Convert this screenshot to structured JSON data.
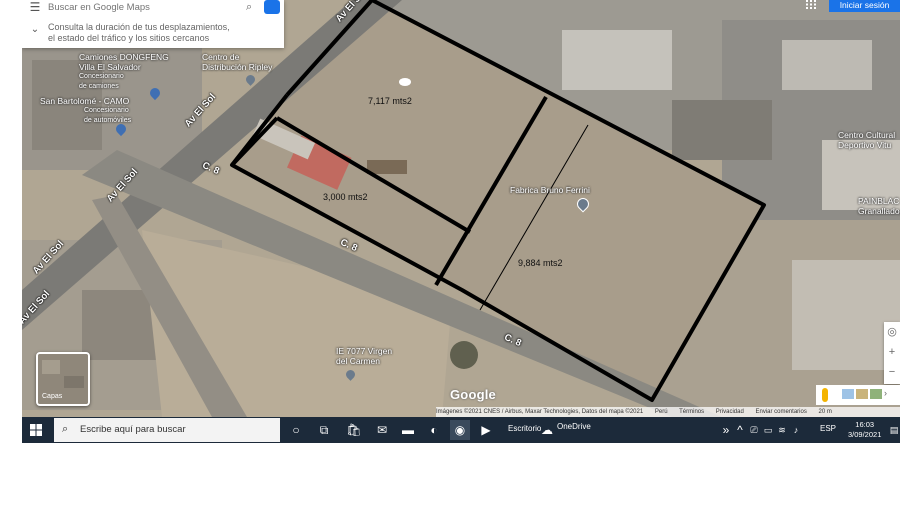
{
  "search": {
    "placeholder": "Buscar en Google Maps",
    "hint_line1": "Consulta la duración de tus desplazamientos,",
    "hint_line2": "el estado del tráfico y los sitios cercanos"
  },
  "header": {
    "signin_label": "Iniciar sesión"
  },
  "map": {
    "parcel_a_area": "7,117 mts2",
    "parcel_b_area": "3,000 mts2",
    "parcel_c_area": "9,884 mts2",
    "streets": {
      "av_el_sol": "Av El Sol",
      "c8": "C. 8"
    },
    "pois": {
      "camiones_l1": "Camiones DONGFENG",
      "camiones_l2": "Villa El Salvador",
      "camiones_l3": "Concesionario",
      "camiones_l4": "de camiones",
      "centro_l1": "Centro de",
      "centro_l2": "Distribución Ripley",
      "bartolome_l1": "San Bartolomé - CAMO",
      "bartolome_l2": "Concesionario",
      "bartolome_l3": "de automóviles",
      "fabrica": "Fabrica Bruno Ferrini",
      "cultural_l1": "Centro Cultural",
      "cultural_l2": "Deportivo Vitu",
      "painblack_l1": "PAINBLAC",
      "painblack_l2": "Granallado, Are",
      "school_l1": "IE 7077 Virgen",
      "school_l2": "del Carmen"
    },
    "layers_label": "Capas",
    "google_logo": "Google",
    "attribution": {
      "imagery": "Imágenes ©2021 CNES / Airbus, Maxar Technologies, Datos del mapa ©2021",
      "country": "Perú",
      "terms": "Términos",
      "privacy": "Privacidad",
      "feedback": "Enviar comentarios",
      "scale": "20 m"
    },
    "zoom_in": "+",
    "zoom_out": "−"
  },
  "taskbar": {
    "search_placeholder": "Escribe aquí para buscar",
    "desktop_label": "Escritorio",
    "onedrive_label": "OneDrive",
    "language": "ESP",
    "time": "16:03",
    "date": "3/09/2021"
  },
  "colors": {
    "parcel_border": "#000000",
    "signin_blue": "#1a73e8",
    "taskbar_bg": "#1c2a3a"
  }
}
